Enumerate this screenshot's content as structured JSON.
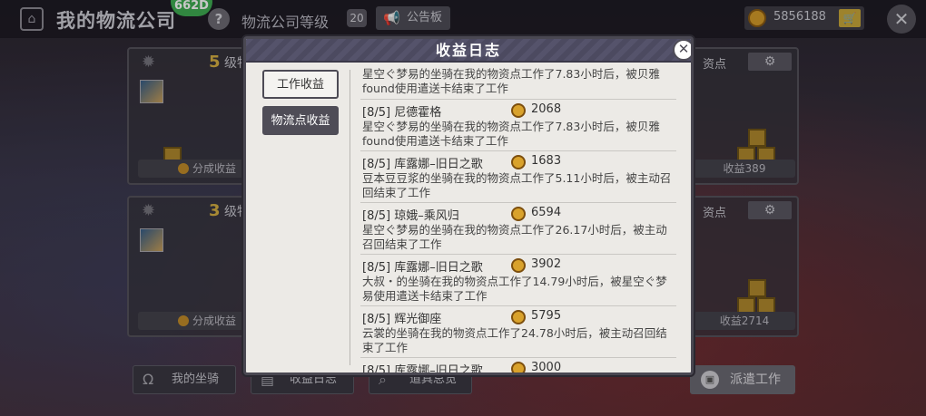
{
  "header": {
    "title": "我的物流公司",
    "badge": "662D",
    "help": "?",
    "level_label": "物流公司等级",
    "level": "20",
    "notice_label": "公告板",
    "coins": "5856188"
  },
  "bg_cards": {
    "left_top": {
      "level_num": "5",
      "level_text": "级物",
      "share": "分成收益"
    },
    "left_bottom": {
      "level_num": "3",
      "level_text": "级物",
      "share": "分成收益"
    },
    "right_top": {
      "title": "资点",
      "income": "收益389"
    },
    "right_bottom": {
      "title": "资点",
      "income": "收益2714"
    }
  },
  "bottom_bar": {
    "mount": "我的坐骑",
    "log": "收益日志",
    "items": "道具总览",
    "dispatch": "派遣工作"
  },
  "modal": {
    "title": "收益日志",
    "tabs": {
      "work": "工作收益",
      "logistics": "物流点收益"
    },
    "entries": [
      {
        "desc": "星空ぐ梦易的坐骑在我的物资点工作了7.83小时后，被贝雅found使用遣送卡结束了工作"
      },
      {
        "date": "[8/5]",
        "name": "尼德霍格",
        "amount": "2068",
        "desc": "星空ぐ梦易的坐骑在我的物资点工作了7.83小时后，被贝雅found使用遣送卡结束了工作"
      },
      {
        "date": "[8/5]",
        "name": "库露娜–旧日之歌",
        "amount": "1683",
        "desc": "豆本豆豆浆的坐骑在我的物资点工作了5.11小时后，被主动召回结束了工作"
      },
      {
        "date": "[8/5]",
        "name": "琼娥–乘风归",
        "amount": "6594",
        "desc": "星空ぐ梦易的坐骑在我的物资点工作了26.17小时后，被主动召回结束了工作"
      },
      {
        "date": "[8/5]",
        "name": "库露娜–旧日之歌",
        "amount": "3902",
        "desc": "大叔・的坐骑在我的物资点工作了14.79小时后，被星空ぐ梦易使用遣送卡结束了工作"
      },
      {
        "date": "[8/5]",
        "name": "辉光御座",
        "amount": "5795",
        "desc": "云裳的坐骑在我的物资点工作了24.78小时后，被主动召回结束了工作"
      },
      {
        "date": "[8/5]",
        "name": "库露娜–旧日之歌",
        "amount": "3000",
        "desc": ""
      }
    ]
  }
}
